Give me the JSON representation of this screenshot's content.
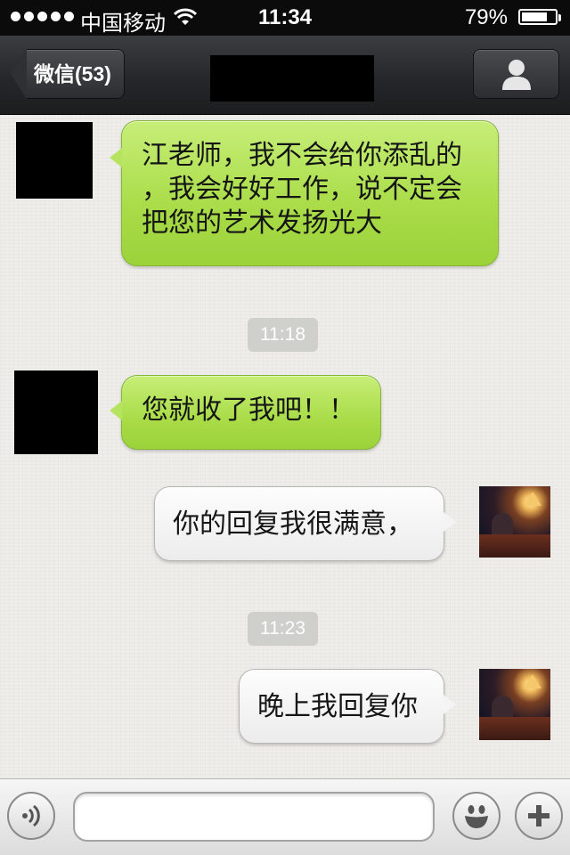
{
  "status_bar": {
    "carrier": "中国移动",
    "time": "11:34",
    "battery_percent": "79%",
    "battery_level": 0.79
  },
  "nav": {
    "back_label": "微信(53)",
    "profile_icon": "person-icon"
  },
  "messages": [
    {
      "side": "left",
      "text_lines": [
        "江老师，我不会给你添乱的",
        "，我会好好工作，说不定会",
        "把您的艺术发扬光大"
      ]
    },
    {
      "type": "timestamp",
      "text": "11:18"
    },
    {
      "side": "left",
      "text": "您就收了我吧！！"
    },
    {
      "side": "right",
      "text": "你的回复我很满意，"
    },
    {
      "type": "timestamp",
      "text": "11:23"
    },
    {
      "side": "right",
      "text": "晚上我回复你"
    }
  ],
  "input_bar": {
    "voice_icon": "voice-icon",
    "emoji_icon": "emoji-icon",
    "plus_icon": "plus-icon",
    "input_value": ""
  },
  "colors": {
    "sent_bubble": "#a9dc48",
    "received_bubble": "#f4f4f4",
    "nav_background": "#26272a"
  }
}
